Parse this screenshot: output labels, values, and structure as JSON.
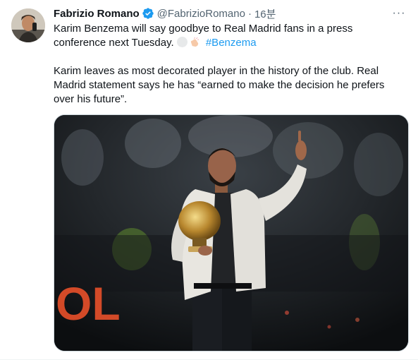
{
  "author": {
    "name": "Fabrizio Romano",
    "handle": "@FabrizioRomano",
    "separator": "·",
    "time": "16분",
    "avatar_icon": "avatar-photo",
    "verified_color": "#1d9bf0"
  },
  "tweet": {
    "line1_text": "Karim Benzema will say goodbye to Real Madrid fans in a press conference next Tuesday.",
    "hashtag": "#Benzema",
    "line2_text": "Karim leaves as most decorated player in the history of the club. Real Madrid statement says he has “earned to make the decision he prefers over his future”."
  },
  "media": {
    "board_text": "OL",
    "board_color": "#e8502a"
  },
  "more_label": "···",
  "colors": {
    "link": "#1d9bf0",
    "secondary": "#536471",
    "text": "#0f1419"
  }
}
